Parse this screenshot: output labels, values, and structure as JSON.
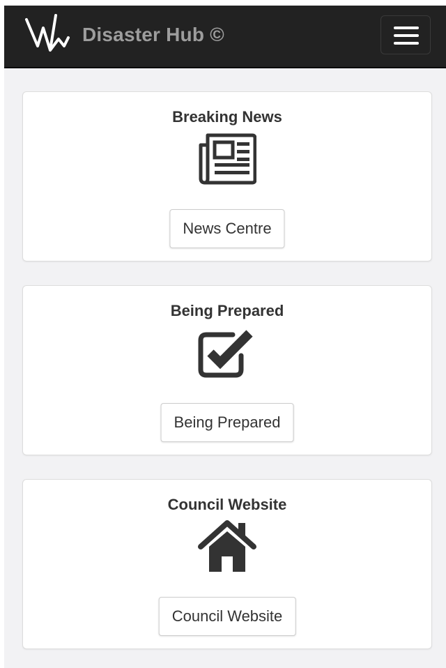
{
  "header": {
    "brand": "Disaster Hub ©",
    "logo_icon": "wave-logo-icon",
    "menu_icon": "hamburger-menu-icon",
    "background": "#222222",
    "brand_color": "#9d9d9d"
  },
  "cards": [
    {
      "title": "Breaking News",
      "icon": "newspaper-icon",
      "button_label": "News Centre"
    },
    {
      "title": "Being Prepared",
      "icon": "checkbox-checked-icon",
      "button_label": "Being Prepared"
    },
    {
      "title": "Council Website",
      "icon": "home-icon",
      "button_label": "Council Website"
    }
  ],
  "colors": {
    "page_background": "#f2f2f4",
    "card_background": "#ffffff",
    "text": "#333333"
  }
}
